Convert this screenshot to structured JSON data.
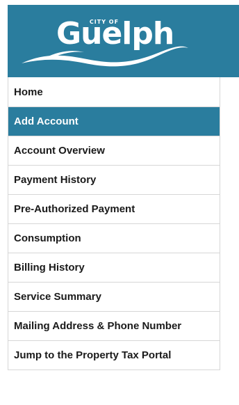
{
  "logo": {
    "city_of": "CITY OF",
    "name": "Guelph"
  },
  "colors": {
    "brand": "#2a7d9e",
    "text": "#1a1a1a",
    "border": "#d6d6d6"
  },
  "nav": {
    "active_index": 1,
    "items": [
      {
        "label": "Home"
      },
      {
        "label": "Add Account"
      },
      {
        "label": "Account Overview"
      },
      {
        "label": "Payment History"
      },
      {
        "label": "Pre-Authorized Payment"
      },
      {
        "label": "Consumption"
      },
      {
        "label": "Billing History"
      },
      {
        "label": "Service Summary"
      },
      {
        "label": "Mailing Address & Phone Number"
      },
      {
        "label": "Jump to the Property Tax Portal"
      }
    ]
  }
}
